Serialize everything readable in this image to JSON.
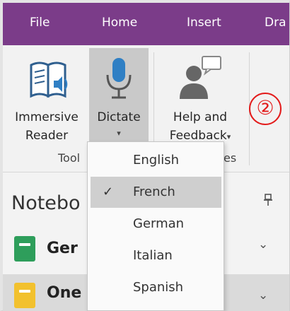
{
  "menubar": {
    "tabs": [
      "File",
      "Home",
      "Insert",
      "Dra"
    ],
    "accent": "#7b3c89"
  },
  "ribbon": {
    "immersive_reader": {
      "line1": "Immersive",
      "line2": "Reader",
      "icon": "book-speaker-icon"
    },
    "dictate": {
      "line1": "Dictate",
      "caret": "▾",
      "icon": "microphone-icon"
    },
    "help_feedback": {
      "line1": "Help and",
      "line2": "Feedback",
      "caret": "▾",
      "icon": "person-speech-icon"
    },
    "group_label_tools": "Tool",
    "group_label_right": "es",
    "annotation_marker": "②",
    "annotation_color": "#e31b1b"
  },
  "notebooks": {
    "title": "Notebo",
    "pin_icon": "pin-icon",
    "items": [
      {
        "name": "Ger",
        "color": "#2e9e5b",
        "chevron": "⌄"
      },
      {
        "name": "One",
        "color": "#f2c12e",
        "chevron": "⌄"
      }
    ]
  },
  "dictate_menu": {
    "items": [
      {
        "label": "English",
        "checked": false
      },
      {
        "label": "French",
        "checked": true,
        "check": "✓"
      },
      {
        "label": "German",
        "checked": false
      },
      {
        "label": "Italian",
        "checked": false
      },
      {
        "label": "Spanish",
        "checked": false
      }
    ]
  }
}
